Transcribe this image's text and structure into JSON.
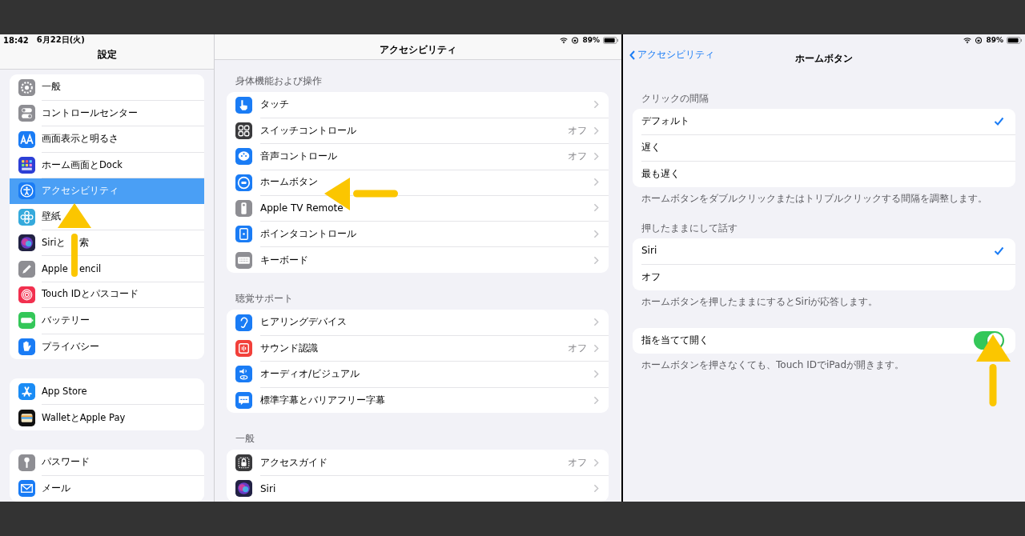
{
  "left_screen": {
    "status": {
      "time": "18:42",
      "date": "6月22日(火)",
      "battery": "89%"
    },
    "sidebar": {
      "title": "設定",
      "groups": [
        {
          "items": [
            {
              "label": "一般",
              "kind": "gear",
              "color": "#8e8e93",
              "selected": false
            },
            {
              "label": "コントロールセンター",
              "kind": "toggles",
              "color": "#8e8e93",
              "selected": false
            },
            {
              "label": "画面表示と明るさ",
              "kind": "text-size",
              "color": "#1a7cf5",
              "selected": false
            },
            {
              "label": "ホーム画面とDock",
              "kind": "app-grid",
              "color": "#2c3fd6",
              "selected": false
            },
            {
              "label": "アクセシビリティ",
              "kind": "person",
              "color": "#1a7cf5",
              "selected": true
            },
            {
              "label": "壁紙",
              "kind": "flower",
              "color": "#35aadc",
              "selected": false
            },
            {
              "label_parts": [
                "Siriと",
                "索"
              ],
              "kind": "orb",
              "color": "#222244",
              "selected": false
            },
            {
              "label_parts": [
                "Apple",
                "encil"
              ],
              "kind": "pencil",
              "color": "#8e8e93",
              "selected": false
            },
            {
              "label": "Touch IDとパスコード",
              "kind": "fingerprint",
              "color": "#f2304f",
              "selected": false
            },
            {
              "label": "バッテリー",
              "kind": "battery",
              "color": "#34c759",
              "selected": false
            },
            {
              "label": "プライバシー",
              "kind": "hand",
              "color": "#1a7cf5",
              "selected": false
            }
          ]
        },
        {
          "items": [
            {
              "label": "App Store",
              "kind": "appstore",
              "color": "#1a8cf5",
              "selected": false
            },
            {
              "label": "WalletとApple Pay",
              "kind": "wallet",
              "color": "#111111",
              "selected": false
            }
          ]
        },
        {
          "items": [
            {
              "label": "パスワード",
              "kind": "key",
              "color": "#8e8e93",
              "selected": false
            },
            {
              "label": "メール",
              "kind": "envelope",
              "color": "#1a7cf5",
              "selected": false
            }
          ]
        }
      ]
    },
    "main": {
      "title": "アクセシビリティ",
      "sections": [
        {
          "header": "身体機能および操作",
          "rows": [
            {
              "label": "タッチ",
              "kind": "pointing-hand",
              "color": "#1a7cf5"
            },
            {
              "label": "スイッチコントロール",
              "value": "オフ",
              "kind": "grid",
              "color": "#3a3a3c"
            },
            {
              "label": "音声コントロール",
              "value": "オフ",
              "kind": "bubble-dots",
              "color": "#1a7cf5"
            },
            {
              "label": "ホームボタン",
              "kind": "home-button",
              "color": "#1a7cf5"
            },
            {
              "label": "Apple TV Remote",
              "kind": "remote",
              "color": "#8e8e93"
            },
            {
              "label": "ポインタコントロール",
              "kind": "pointer",
              "color": "#1a7cf5"
            },
            {
              "label": "キーボード",
              "kind": "keyboard",
              "color": "#8e8e93"
            }
          ]
        },
        {
          "header": "聴覚サポート",
          "rows": [
            {
              "label": "ヒアリングデバイス",
              "kind": "ear",
              "color": "#1a7cf5"
            },
            {
              "label": "サウンド認識",
              "value": "オフ",
              "kind": "waveform",
              "color": "#f2403a"
            },
            {
              "label": "オーディオ/ビジュアル",
              "kind": "speaker",
              "color": "#1a7cf5"
            },
            {
              "label": "標準字幕とバリアフリー字幕",
              "kind": "caption",
              "color": "#1a7cf5"
            }
          ]
        },
        {
          "header": "一般",
          "rows": [
            {
              "label": "アクセスガイド",
              "value": "オフ",
              "kind": "lock",
              "color": "#3a3a3c"
            },
            {
              "label": "Siri",
              "kind": "orb",
              "color": "#222244"
            }
          ]
        }
      ]
    }
  },
  "right_screen": {
    "status": {
      "battery": "89%"
    },
    "back": "アクセシビリティ",
    "title": "ホームボタン",
    "sections": [
      {
        "header": "クリックの間隔",
        "rows": [
          {
            "label": "デフォルト",
            "kind": "option",
            "selected": true
          },
          {
            "label": "遅く",
            "kind": "option",
            "selected": false
          },
          {
            "label": "最も遅く",
            "kind": "option",
            "selected": false
          }
        ],
        "footer": "ホームボタンをダブルクリックまたはトリプルクリックする間隔を調整します。"
      },
      {
        "header": "押したままにして話す",
        "rows": [
          {
            "label": "Siri",
            "kind": "option",
            "selected": true
          },
          {
            "label": "オフ",
            "kind": "option",
            "selected": false
          }
        ],
        "footer": "ホームボタンを押したままにするとSiriが応答します。"
      },
      {
        "rows": [
          {
            "label": "指を当てて開く",
            "kind": "toggle",
            "on": true
          }
        ],
        "footer": "ホームボタンを押さなくても、Touch IDでiPadが開きます。"
      }
    ]
  }
}
